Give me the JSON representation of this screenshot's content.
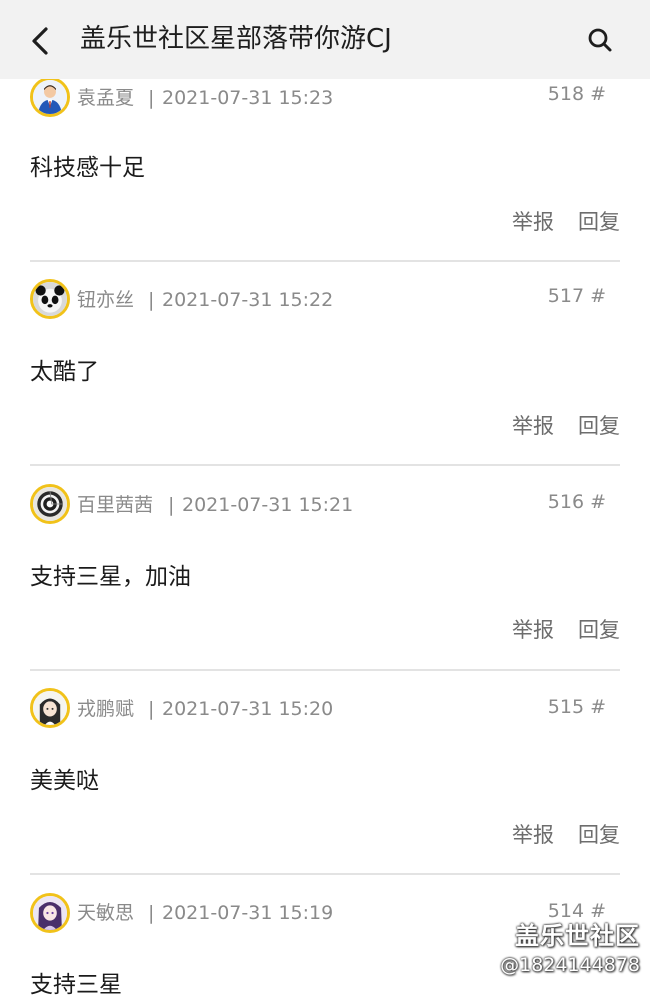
{
  "header": {
    "title": "盖乐世社区星部落带你游CJ",
    "back_icon": "chevron-left-icon",
    "search_icon": "search-icon"
  },
  "posts": [
    {
      "username": "袁孟夏",
      "separator": "|",
      "timestamp": "2021-07-31 15:23",
      "floor": "518 #",
      "content": "科技感十足",
      "report_label": "举报",
      "reply_label": "回复",
      "avatar_icon": "businessman-avatar"
    },
    {
      "username": "钮亦丝",
      "separator": "|",
      "timestamp": "2021-07-31 15:22",
      "floor": "517 #",
      "content": "太酷了",
      "report_label": "举报",
      "reply_label": "回复",
      "avatar_icon": "panda-avatar"
    },
    {
      "username": "百里茜茜",
      "separator": "|",
      "timestamp": "2021-07-31 15:21",
      "floor": "516 #",
      "content": "支持三星，加油",
      "report_label": "举报",
      "reply_label": "回复",
      "avatar_icon": "spiral-avatar"
    },
    {
      "username": "戎鹏赋",
      "separator": "|",
      "timestamp": "2021-07-31 15:20",
      "floor": "515 #",
      "content": "美美哒",
      "report_label": "举报",
      "reply_label": "回复",
      "avatar_icon": "anime-girl-avatar"
    },
    {
      "username": "天敏思",
      "separator": "|",
      "timestamp": "2021-07-31 15:19",
      "floor": "514 #",
      "content": "支持三星",
      "report_label": "",
      "reply_label": "",
      "avatar_icon": "anime-character-avatar"
    }
  ],
  "watermark": {
    "brand": "盖乐世社区",
    "user": "@1824144878"
  },
  "colors": {
    "header_bg": "#f2f2f2",
    "avatar_ring": "#f1c21a",
    "meta_text": "#8a8a8a",
    "divider": "#e3e3e3"
  }
}
